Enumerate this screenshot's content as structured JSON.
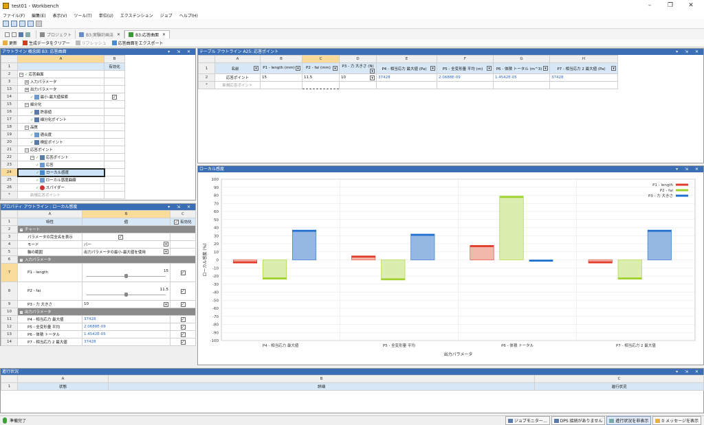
{
  "window": {
    "title": "test01 - Workbench"
  },
  "menu": [
    "ファイル(F)",
    "編集(E)",
    "表示(V)",
    "ツール(T)",
    "単位(U)",
    "エクステンション",
    "ジョブ",
    "ヘルプ(H)"
  ],
  "tabs": [
    {
      "label": "プロジェクト",
      "active": false,
      "closable": false
    },
    {
      "label": "B3:実験計画法",
      "active": false,
      "closable": true
    },
    {
      "label": "B3:応答曲面",
      "active": true,
      "closable": true
    }
  ],
  "toolbar": {
    "update": "更新",
    "clear": "生成データをクリアー",
    "refresh": "リフレッシュ",
    "export": "応答曲面をエクスポート"
  },
  "outline": {
    "title": "アウトライン 概念図 B3: 応答曲面",
    "col_a": "A",
    "col_b": "B",
    "col_b_header": "有効化",
    "rows": [
      {
        "n": "1",
        "label": "",
        "indent": 0
      },
      {
        "n": "2",
        "label": "応答曲面",
        "indent": 0,
        "exp": "⊟",
        "check": true
      },
      {
        "n": "3",
        "label": "入力パラメータ",
        "indent": 1,
        "exp": "⊞"
      },
      {
        "n": "13",
        "label": "出力パラメータ",
        "indent": 1,
        "exp": "⊞"
      },
      {
        "n": "14",
        "label": "最小-最大値探索",
        "indent": 2,
        "check": true,
        "icon": "chart",
        "enabled": true
      },
      {
        "n": "15",
        "label": "細分化",
        "indent": 1,
        "exp": "⊟"
      },
      {
        "n": "16",
        "label": "許容値",
        "indent": 2,
        "check": true,
        "icon": "table"
      },
      {
        "n": "17",
        "label": "細分化ポイント",
        "indent": 2,
        "check": true,
        "icon": "table"
      },
      {
        "n": "18",
        "label": "品質",
        "indent": 1,
        "exp": "⊟"
      },
      {
        "n": "19",
        "label": "適合度",
        "indent": 2,
        "check": true,
        "icon": "chart"
      },
      {
        "n": "20",
        "label": "検証ポイント",
        "indent": 2,
        "check": true,
        "icon": "table"
      },
      {
        "n": "21",
        "label": "応答ポイント",
        "indent": 1,
        "exp": "⊟"
      },
      {
        "n": "22",
        "label": "応答ポイント",
        "indent": 2,
        "exp": "⊟",
        "check": true,
        "icon": "table"
      },
      {
        "n": "23",
        "label": "応答",
        "indent": 3,
        "check": true,
        "icon": "chart"
      },
      {
        "n": "24",
        "label": "ローカル感度",
        "indent": 3,
        "check": true,
        "icon": "bar",
        "selected": true
      },
      {
        "n": "25",
        "label": "ローカル感度曲線",
        "indent": 3,
        "check": true,
        "icon": "curve"
      },
      {
        "n": "26",
        "label": "スパイダー",
        "indent": 3,
        "check": true,
        "icon": "spider"
      },
      {
        "n": "*",
        "label": "新規応答ポイント",
        "indent": 2,
        "gray": true
      }
    ]
  },
  "table": {
    "title": "テーブル アウトライン A25: 応答ポイント",
    "cols": [
      "A",
      "B",
      "C",
      "D",
      "E",
      "F",
      "G",
      "H"
    ],
    "headers": [
      "名前",
      "P1 - length (mm)",
      "P2 - fai (mm)",
      "P3 - 力 大きさ (N)",
      "P4 - 相当応力 最大値 (Pa)",
      "P5 - 全変形量 平均 (m)",
      "P6 - 体積 トータル (m^3)",
      "P7 - 相当応力 2 最大値 (Pa)"
    ],
    "row2": [
      "応答ポイント",
      "15",
      "11.5",
      "10",
      "37428",
      "2.0688E-09",
      "1.4542E-05",
      "37428"
    ],
    "new_row": "新規応答ポイント"
  },
  "props": {
    "title": "プロパティ アウトライン : ローカル感度",
    "cols": [
      "A",
      "B",
      "C"
    ],
    "h_a": "特性",
    "h_b": "値",
    "h_c": "有効化",
    "sect_chart": "チャート",
    "full_names": "パラメータの完全名を表示",
    "mode_label": "モード",
    "mode_value": "バー",
    "axis_label": "軸の範囲",
    "axis_value": "出力パラメータの最小-最大値を使用",
    "sect_input": "入力パラメータ",
    "p1_label": "P1 - length",
    "p1_value": "15",
    "p2_label": "P2 - fai",
    "p2_value": "11.5",
    "p3_label": "P3 - 力 大きさ",
    "p3_value": "10",
    "sect_output": "出力パラメータ",
    "p4_label": "P4 - 相当応力 最大値",
    "p4_value": "37428",
    "p5_label": "P5 - 全変形量 平均",
    "p5_value": "2.0688E-09",
    "p6_label": "P6 - 体積 トータル",
    "p6_value": "1.4542E-05",
    "p7_label": "P7 - 相当応力 2 最大値",
    "p7_value": "37428"
  },
  "chart_panel": {
    "title": "ローカル感度"
  },
  "chart_data": {
    "type": "bar",
    "categories": [
      "P4 - 相当応力 最大値",
      "P5 - 全変形量 平均",
      "P6 - 体積 トータル",
      "P7 - 相当応力 2 最大値"
    ],
    "series": [
      {
        "name": "P1 - length",
        "color": "#e03a2a",
        "values": [
          -4,
          5,
          18,
          -4
        ]
      },
      {
        "name": "P2 - fai",
        "color": "#9ed22a",
        "values": [
          -24,
          -25,
          79,
          -24
        ]
      },
      {
        "name": "P3 - 力 大きさ",
        "color": "#1f6fd0",
        "values": [
          37,
          32,
          0,
          37
        ]
      }
    ],
    "xlabel": "出力パラメータ",
    "ylabel": "ローカル感度 (%)",
    "ylim": [
      -100,
      100
    ],
    "yticks": [
      "100",
      "90",
      "80",
      "70",
      "60",
      "50",
      "40",
      "30",
      "20",
      "10",
      "0",
      "-10",
      "-20",
      "-30",
      "-40",
      "-50",
      "-60",
      "-70",
      "-80",
      "-90",
      "-100"
    ],
    "grid": true,
    "legend": "top-right"
  },
  "progress": {
    "title": "進行状況",
    "cols": [
      "A",
      "B",
      "C"
    ],
    "headers": [
      "状態",
      "詳細",
      "進行状況"
    ]
  },
  "status": {
    "ready": "準備完了",
    "job_monitor": "ジョブモニター...",
    "dps": "DPS 接続がありません",
    "hide_progress": "進行状況を非表示",
    "messages": "0 メッセージを表示"
  }
}
